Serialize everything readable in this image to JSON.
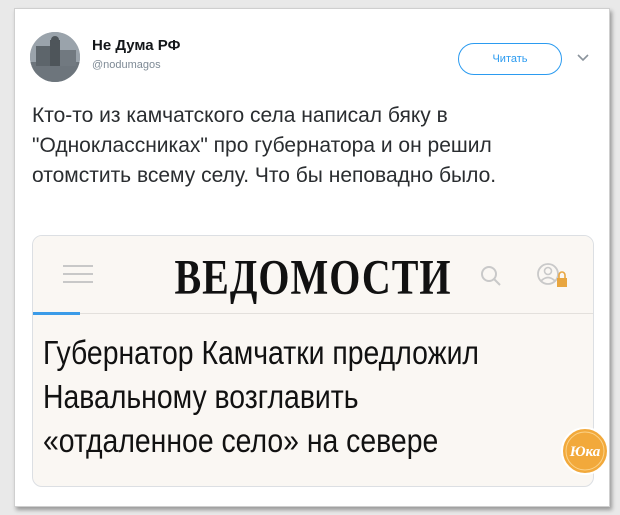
{
  "tweet": {
    "display_name": "Не Дума РФ",
    "handle": "@nodumagos",
    "follow_label": "Читать",
    "text": "Кто-то из камчатского села написал бяку в \"Одноклассниках\" про губернатора и он решил отомстить всему селу. Что бы неповадно было."
  },
  "embed": {
    "logo": "ВЕДОМОСТИ",
    "headline_lines": [
      "Губернатор Камчатки предложил",
      "Навальному возглавить",
      "«отдаленное село» на севере"
    ]
  },
  "badge": {
    "text": "Юка"
  },
  "colors": {
    "accent": "#2b9bf0",
    "headline_accent": "#3b9be8",
    "badge": "#f2a93b"
  },
  "icons": [
    "avatar",
    "chevron-down-icon",
    "menu-icon",
    "search-icon",
    "user-lock-icon"
  ]
}
